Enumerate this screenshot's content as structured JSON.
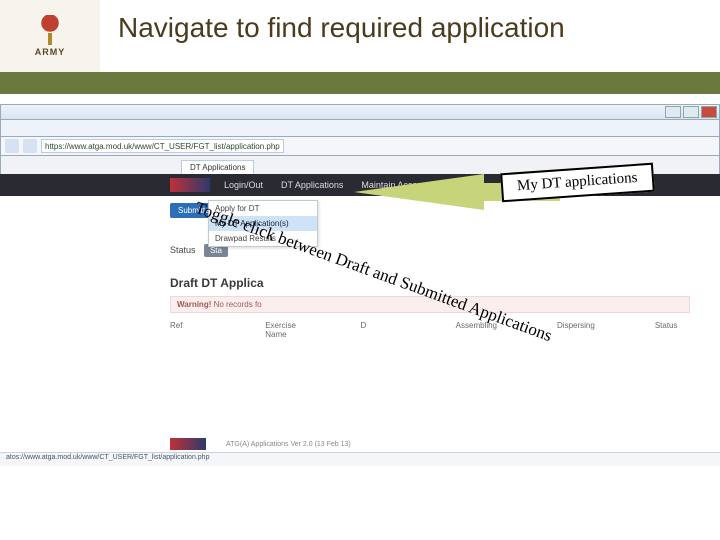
{
  "header": {
    "logo_text": "ARMY",
    "title": "Navigate to find required application"
  },
  "browser": {
    "url": "https://www.atga.mod.uk/www/CT_USER/FGT_list/application.php",
    "tab_label": "DT Applications"
  },
  "app": {
    "topnav": {
      "login": "Login/Out",
      "dtapps": "DT Applications",
      "maintain": "Maintain Account"
    },
    "menu": {
      "apply": "Apply for DT",
      "myapps": "My DT Application(s)",
      "drawpad": "Drawpad Results"
    },
    "submitted_btn": "Submitted Applications",
    "status_btn": "Sta",
    "draft_heading": "Draft DT Applica",
    "warning_label": "Warning!",
    "warning_text": "No records fo",
    "table": {
      "ref": "Ref",
      "exname": "Exercise Name",
      "d": "D",
      "assembling": "Assembling",
      "dispersing": "Dispersing",
      "status": "Status"
    },
    "footer_text": "ATG(A) Applications Ver 2.0 (13 Feb 13)",
    "statusbar": "atos://www.atga.mod.uk/www/CT_USER/FGT_list/application.php"
  },
  "callouts": {
    "box": "My DT applications",
    "line": "Toggle click between Draft and Submitted Applications"
  }
}
